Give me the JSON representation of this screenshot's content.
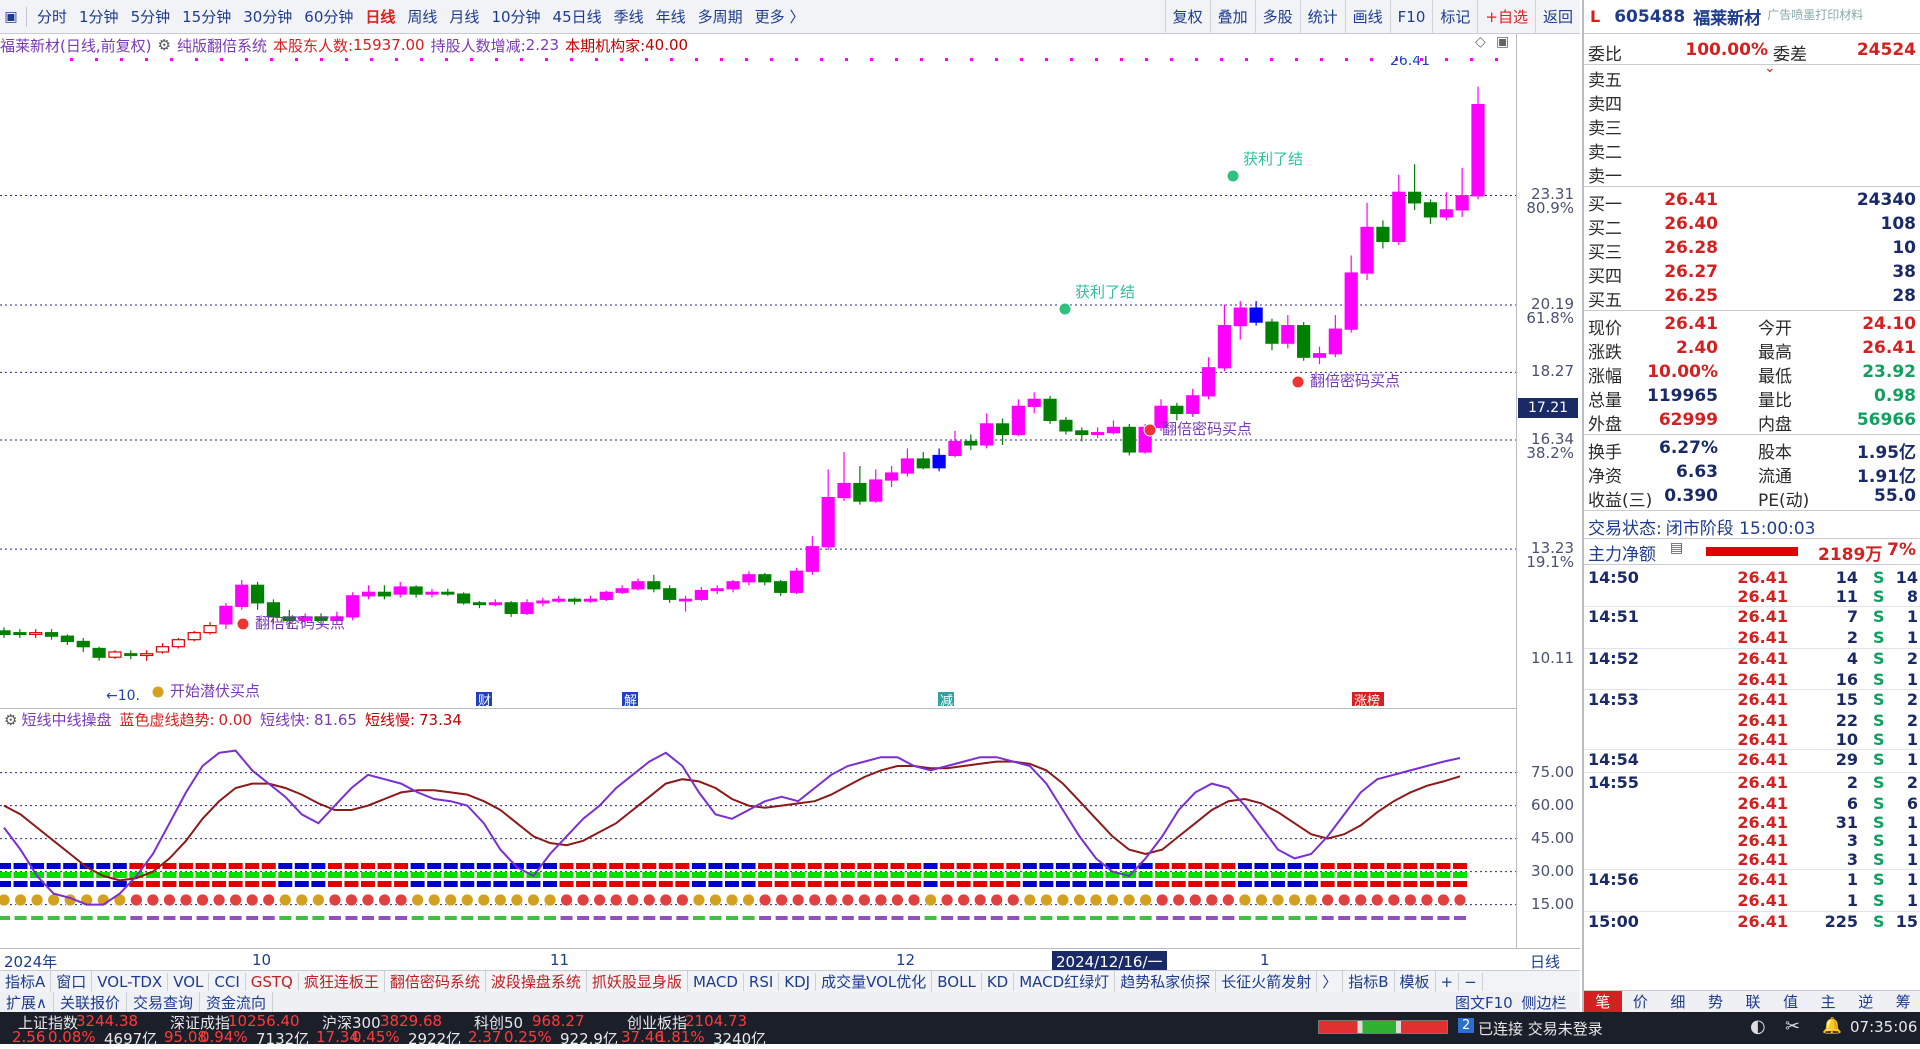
{
  "toolbar": {
    "periods": [
      "分时",
      "1分钟",
      "5分钟",
      "15分钟",
      "30分钟",
      "60分钟",
      "日线",
      "周线",
      "月线",
      "10分钟",
      "45日线",
      "季线",
      "年线",
      "多周期",
      "更多 〉"
    ],
    "active_period": "日线",
    "right_buttons": [
      "复权",
      "叠加",
      "多股",
      "统计",
      "画线",
      "F10",
      "标记",
      "+自选",
      "返回"
    ]
  },
  "info": {
    "stock_label": "福莱新材(日线,前复权)",
    "system": "纯版翻倍系统",
    "holders_label": "本股东人数:",
    "holders_value": "15937.00",
    "holders_change_label": "持股人数增减:",
    "holders_change_value": "2.23",
    "inst_label": "本期机构家:",
    "inst_value": "40.00"
  },
  "price_axis": {
    "labels": [
      "23.31",
      "20.19",
      "18.27",
      "16.34",
      "13.23",
      "10.11"
    ],
    "pct_labels": [
      "80.9%",
      "61.8%",
      "38.2%",
      "19.1%"
    ],
    "current_tag": "17.21"
  },
  "chart_data": {
    "type": "candlestick",
    "ylim": [
      10.11,
      26.41
    ],
    "candles": [
      [
        10.9,
        10.8,
        11.0,
        10.7
      ],
      [
        10.85,
        10.8,
        10.95,
        10.7
      ],
      [
        10.8,
        10.85,
        10.95,
        10.7
      ],
      [
        10.85,
        10.75,
        10.95,
        10.65
      ],
      [
        10.75,
        10.6,
        10.8,
        10.5
      ],
      [
        10.6,
        10.45,
        10.7,
        10.3
      ],
      [
        10.4,
        10.15,
        10.45,
        10.05
      ],
      [
        10.15,
        10.3,
        10.35,
        10.1
      ],
      [
        10.25,
        10.2,
        10.35,
        10.1
      ],
      [
        10.2,
        10.25,
        10.35,
        10.05
      ],
      [
        10.3,
        10.45,
        10.55,
        10.25
      ],
      [
        10.45,
        10.65,
        10.7,
        10.4
      ],
      [
        10.65,
        10.85,
        10.9,
        10.6
      ],
      [
        10.85,
        11.05,
        11.15,
        10.8
      ],
      [
        11.1,
        11.6,
        11.7,
        10.95
      ],
      [
        11.6,
        12.2,
        12.35,
        11.5
      ],
      [
        12.2,
        11.7,
        12.3,
        11.5
      ],
      [
        11.7,
        11.3,
        11.8,
        11.1
      ],
      [
        11.3,
        11.2,
        11.5,
        11.0
      ],
      [
        11.2,
        11.3,
        11.4,
        11.05
      ],
      [
        11.3,
        11.2,
        11.4,
        11.05
      ],
      [
        11.2,
        11.3,
        11.45,
        11.1
      ],
      [
        11.3,
        11.9,
        12.0,
        11.2
      ],
      [
        11.9,
        12.0,
        12.2,
        11.8
      ],
      [
        12.0,
        11.9,
        12.2,
        11.8
      ],
      [
        11.95,
        12.15,
        12.3,
        11.85
      ],
      [
        12.15,
        11.95,
        12.2,
        11.85
      ],
      [
        11.95,
        12.0,
        12.1,
        11.85
      ],
      [
        12.0,
        11.95,
        12.1,
        11.9
      ],
      [
        11.95,
        11.7,
        12.0,
        11.65
      ],
      [
        11.7,
        11.65,
        11.75,
        11.55
      ],
      [
        11.65,
        11.7,
        11.8,
        11.6
      ],
      [
        11.7,
        11.4,
        11.75,
        11.3
      ],
      [
        11.4,
        11.7,
        11.8,
        11.35
      ],
      [
        11.7,
        11.75,
        11.85,
        11.6
      ],
      [
        11.75,
        11.8,
        11.9,
        11.7
      ],
      [
        11.8,
        11.75,
        11.85,
        11.65
      ],
      [
        11.75,
        11.8,
        11.9,
        11.7
      ],
      [
        11.8,
        12.0,
        12.05,
        11.75
      ],
      [
        12.0,
        12.1,
        12.2,
        11.95
      ],
      [
        12.1,
        12.3,
        12.4,
        12.05
      ],
      [
        12.3,
        12.1,
        12.5,
        12.0
      ],
      [
        12.1,
        11.8,
        12.2,
        11.7
      ],
      [
        11.8,
        11.8,
        11.9,
        11.45
      ],
      [
        11.8,
        12.05,
        12.15,
        11.75
      ],
      [
        12.05,
        12.1,
        12.2,
        11.95
      ],
      [
        12.1,
        12.3,
        12.35,
        12.0
      ],
      [
        12.3,
        12.5,
        12.6,
        12.2
      ],
      [
        12.5,
        12.3,
        12.55,
        12.2
      ],
      [
        12.3,
        12.0,
        12.35,
        11.9
      ],
      [
        12.0,
        12.6,
        12.7,
        11.95
      ],
      [
        12.6,
        13.3,
        13.6,
        12.5
      ],
      [
        13.3,
        14.7,
        15.5,
        13.2
      ],
      [
        14.7,
        15.1,
        16.0,
        14.6
      ],
      [
        15.1,
        14.6,
        15.6,
        14.5
      ],
      [
        14.6,
        15.2,
        15.5,
        14.55
      ],
      [
        15.2,
        15.4,
        15.6,
        15.0
      ],
      [
        15.4,
        15.8,
        16.1,
        15.3
      ],
      [
        15.8,
        15.55,
        16.0,
        15.5
      ],
      [
        15.55,
        15.9,
        16.1,
        15.45
      ],
      [
        15.9,
        16.3,
        16.6,
        15.85
      ],
      [
        16.3,
        16.2,
        16.5,
        16.05
      ],
      [
        16.2,
        16.8,
        17.1,
        16.1
      ],
      [
        16.8,
        16.5,
        16.95,
        16.2
      ],
      [
        16.5,
        17.3,
        17.5,
        16.45
      ],
      [
        17.3,
        17.5,
        17.7,
        17.1
      ],
      [
        17.5,
        16.9,
        17.6,
        16.8
      ],
      [
        16.9,
        16.6,
        17.0,
        16.5
      ],
      [
        16.6,
        16.5,
        16.7,
        16.3
      ],
      [
        16.5,
        16.55,
        16.7,
        16.4
      ],
      [
        16.55,
        16.7,
        16.9,
        16.5
      ],
      [
        16.7,
        16.0,
        16.8,
        15.9
      ],
      [
        16.0,
        16.7,
        16.8,
        15.95
      ],
      [
        16.7,
        17.3,
        17.5,
        16.6
      ],
      [
        17.3,
        17.1,
        17.4,
        16.9
      ],
      [
        17.1,
        17.6,
        17.8,
        17.0
      ],
      [
        17.6,
        18.4,
        18.7,
        17.5
      ],
      [
        18.4,
        19.6,
        20.2,
        18.3
      ],
      [
        19.6,
        20.1,
        20.3,
        19.2
      ],
      [
        20.1,
        19.7,
        20.3,
        19.6
      ],
      [
        19.7,
        19.1,
        19.8,
        18.9
      ],
      [
        19.1,
        19.6,
        19.9,
        18.95
      ],
      [
        19.6,
        18.7,
        19.7,
        18.6
      ],
      [
        18.7,
        18.8,
        19.0,
        18.5
      ],
      [
        18.8,
        19.5,
        19.9,
        18.7
      ],
      [
        19.5,
        21.1,
        21.6,
        19.4
      ],
      [
        21.1,
        22.4,
        23.1,
        20.9
      ],
      [
        22.4,
        22.0,
        22.6,
        21.8
      ],
      [
        22.0,
        23.4,
        23.9,
        21.9
      ],
      [
        23.4,
        23.1,
        24.2,
        22.9
      ],
      [
        23.1,
        22.7,
        23.2,
        22.5
      ],
      [
        22.7,
        22.9,
        23.4,
        22.6
      ],
      [
        22.9,
        23.3,
        24.1,
        22.7
      ],
      [
        23.3,
        25.9,
        26.41,
        23.2
      ]
    ],
    "ma_note": ""
  },
  "annotations": {
    "buy1": "翻倍密码买点",
    "buy2": "开始潜伏买点",
    "buy3": "翻倍密码买点",
    "buy4": "翻倍密码买点",
    "profit1": "获利了结",
    "profit2": "获利了结",
    "low_label": "←10.",
    "high_label": "26.41",
    "markers": [
      "财",
      "解",
      "减",
      "涨榜"
    ]
  },
  "sub": {
    "title": "短线中线操盘",
    "trend_label": "蓝色虚线趋势:",
    "trend_value": "0.00",
    "fast_label": "短线快:",
    "fast_value": "81.65",
    "slow_label": "短线慢:",
    "slow_value": "73.34",
    "axis": [
      "75.00",
      "60.00",
      "45.00",
      "30.00",
      "15.00"
    ]
  },
  "subchart_data": {
    "fast": [
      50,
      40,
      28,
      20,
      18,
      15,
      15,
      20,
      28,
      38,
      52,
      66,
      78,
      84,
      85,
      76,
      70,
      64,
      56,
      52,
      60,
      68,
      74,
      72,
      70,
      66,
      63,
      62,
      60,
      52,
      40,
      32,
      28,
      38,
      46,
      54,
      60,
      68,
      74,
      80,
      84,
      78,
      66,
      56,
      54,
      58,
      62,
      64,
      62,
      68,
      74,
      78,
      80,
      82,
      82,
      78,
      76,
      78,
      80,
      82,
      82,
      80,
      78,
      70,
      58,
      46,
      36,
      30,
      28,
      36,
      46,
      58,
      66,
      70,
      68,
      60,
      50,
      40,
      36,
      38,
      46,
      56,
      66,
      72,
      74,
      76,
      78,
      80,
      81.65
    ],
    "slow": [
      60,
      56,
      50,
      44,
      38,
      32,
      28,
      26,
      27,
      30,
      36,
      44,
      54,
      62,
      68,
      70,
      70,
      68,
      65,
      61,
      58,
      58,
      60,
      63,
      66,
      67,
      67,
      66,
      65,
      62,
      58,
      52,
      46,
      43,
      42,
      44,
      48,
      52,
      58,
      64,
      70,
      72,
      71,
      68,
      63,
      60,
      59,
      60,
      61,
      62,
      65,
      69,
      73,
      76,
      78,
      78,
      77,
      77,
      78,
      79,
      80,
      80,
      79,
      76,
      70,
      62,
      54,
      46,
      40,
      38,
      40,
      46,
      52,
      58,
      62,
      63,
      61,
      57,
      52,
      47,
      45,
      47,
      51,
      57,
      62,
      66,
      69,
      71,
      73.34
    ]
  },
  "dates": [
    "2024年",
    "10",
    "11",
    "12",
    "2024/12/16/一",
    "1"
  ],
  "period_label": "日线",
  "indicator_tabs": [
    "指标A",
    "窗口",
    "VOL-TDX",
    "VOL",
    "CCI",
    "GSTQ",
    "疯狂连板王",
    "翻倍密码系统",
    "波段操盘系统",
    "抓妖股显身版",
    "MACD",
    "RSI",
    "KDJ",
    "成交量VOL优化",
    "BOLL",
    "KD",
    "MACD红绿灯",
    "趋势私家侦探",
    "长征火箭发射",
    "〉",
    "指标B",
    "模板",
    "+",
    "−"
  ],
  "bottom_tabs": [
    "扩展∧",
    "关联报价",
    "交易查询",
    "资金流向"
  ],
  "bottom_right": [
    "图文F10",
    "侧边栏"
  ],
  "quote": {
    "code": "605488",
    "name": "福莱新材",
    "ad_text": "广告喷墨打印材料",
    "weibi_label": "委比",
    "weibi_value": "100.00%",
    "weicha_label": "委差",
    "weicha_value": "24524",
    "sells": [
      "卖五",
      "卖四",
      "卖三",
      "卖二",
      "卖一"
    ],
    "buys": [
      {
        "label": "买一",
        "price": "26.41",
        "vol": "24340"
      },
      {
        "label": "买二",
        "price": "26.40",
        "vol": "108"
      },
      {
        "label": "买三",
        "price": "26.28",
        "vol": "10"
      },
      {
        "label": "买四",
        "price": "26.27",
        "vol": "38"
      },
      {
        "label": "买五",
        "price": "26.25",
        "vol": "28"
      }
    ],
    "stats": [
      {
        "l1": "现价",
        "v1": "26.41",
        "l2": "今开",
        "v2": "24.10",
        "c2": "#d42020"
      },
      {
        "l1": "涨跌",
        "v1": "2.40",
        "l2": "最高",
        "v2": "26.41",
        "c2": "#d42020"
      },
      {
        "l1": "涨幅",
        "v1": "10.00%",
        "l2": "最低",
        "v2": "23.92",
        "c2": "#11a060"
      },
      {
        "l1": "总量",
        "v1": "119965",
        "l2": "量比",
        "v2": "0.98",
        "c2": "#11a060"
      },
      {
        "l1": "外盘",
        "v1": "62999",
        "l2": "内盘",
        "v2": "56966",
        "c2": "#11a060"
      }
    ],
    "stats2": [
      {
        "l1": "换手",
        "v1": "6.27%",
        "l2": "股本",
        "v2": "1.95亿"
      },
      {
        "l1": "净资",
        "v1": "6.63",
        "l2": "流通",
        "v2": "1.91亿"
      },
      {
        "l1": "收益(三)",
        "v1": "0.390",
        "l2": "PE(动)",
        "v2": "55.0"
      }
    ],
    "status_label": "交易状态:",
    "status_value": "闭市阶段 15:00:03",
    "net_label": "主力净额",
    "net_value": "2189万",
    "net_pct": "7%",
    "ticks": [
      {
        "t": "14:50",
        "p": "26.41",
        "q": "14",
        "s": "S",
        "n": "14"
      },
      {
        "t": "",
        "p": "26.41",
        "q": "11",
        "s": "S",
        "n": "8"
      },
      {
        "t": "14:51",
        "p": "26.41",
        "q": "7",
        "s": "S",
        "n": "1"
      },
      {
        "t": "",
        "p": "26.41",
        "q": "2",
        "s": "S",
        "n": "1"
      },
      {
        "t": "14:52",
        "p": "26.41",
        "q": "4",
        "s": "S",
        "n": "2"
      },
      {
        "t": "",
        "p": "26.41",
        "q": "16",
        "s": "S",
        "n": "1"
      },
      {
        "t": "14:53",
        "p": "26.41",
        "q": "15",
        "s": "S",
        "n": "2"
      },
      {
        "t": "",
        "p": "26.41",
        "q": "22",
        "s": "S",
        "n": "2"
      },
      {
        "t": "",
        "p": "26.41",
        "q": "10",
        "s": "S",
        "n": "1"
      },
      {
        "t": "14:54",
        "p": "26.41",
        "q": "29",
        "s": "S",
        "n": "1"
      },
      {
        "t": "14:55",
        "p": "26.41",
        "q": "2",
        "s": "S",
        "n": "2"
      },
      {
        "t": "",
        "p": "26.41",
        "q": "6",
        "s": "S",
        "n": "6"
      },
      {
        "t": "",
        "p": "26.41",
        "q": "31",
        "s": "S",
        "n": "1"
      },
      {
        "t": "",
        "p": "26.41",
        "q": "3",
        "s": "S",
        "n": "1"
      },
      {
        "t": "",
        "p": "26.41",
        "q": "3",
        "s": "S",
        "n": "1"
      },
      {
        "t": "14:56",
        "p": "26.41",
        "q": "1",
        "s": "S",
        "n": "1"
      },
      {
        "t": "",
        "p": "26.41",
        "q": "1",
        "s": "S",
        "n": "1"
      },
      {
        "t": "15:00",
        "p": "26.41",
        "q": "225",
        "s": "S",
        "n": "15"
      }
    ],
    "tabs": [
      "笔",
      "价",
      "细",
      "势",
      "联",
      "值",
      "主",
      "逆",
      "筹"
    ]
  },
  "statusbar": {
    "indices": [
      {
        "name": "上证指数",
        "value": "3244.38",
        "chg": "2.56",
        "pct": "0.08%",
        "amt": "4697亿"
      },
      {
        "name": "深证成指",
        "value": "10256.40",
        "chg": "95.08",
        "pct": "0.94%",
        "amt": "7132亿"
      },
      {
        "name": "沪深300",
        "value": "3829.68",
        "chg": "17.34",
        "pct": "0.45%",
        "amt": "2922亿"
      },
      {
        "name": "科创50",
        "value": "968.27",
        "chg": "2.37",
        "pct": "0.25%",
        "amt": "922.9亿"
      },
      {
        "name": "创业板指",
        "value": "2104.73",
        "chg": "37.46",
        "pct": "1.81%",
        "amt": "3240亿"
      }
    ],
    "conn_num": "2",
    "conn_text": "已连接 交易未登录",
    "time": "07:35:06"
  },
  "colors": {
    "up": "#ff00ff",
    "down": "#008000",
    "blue": "#0000ff",
    "accent": "#d42020"
  }
}
